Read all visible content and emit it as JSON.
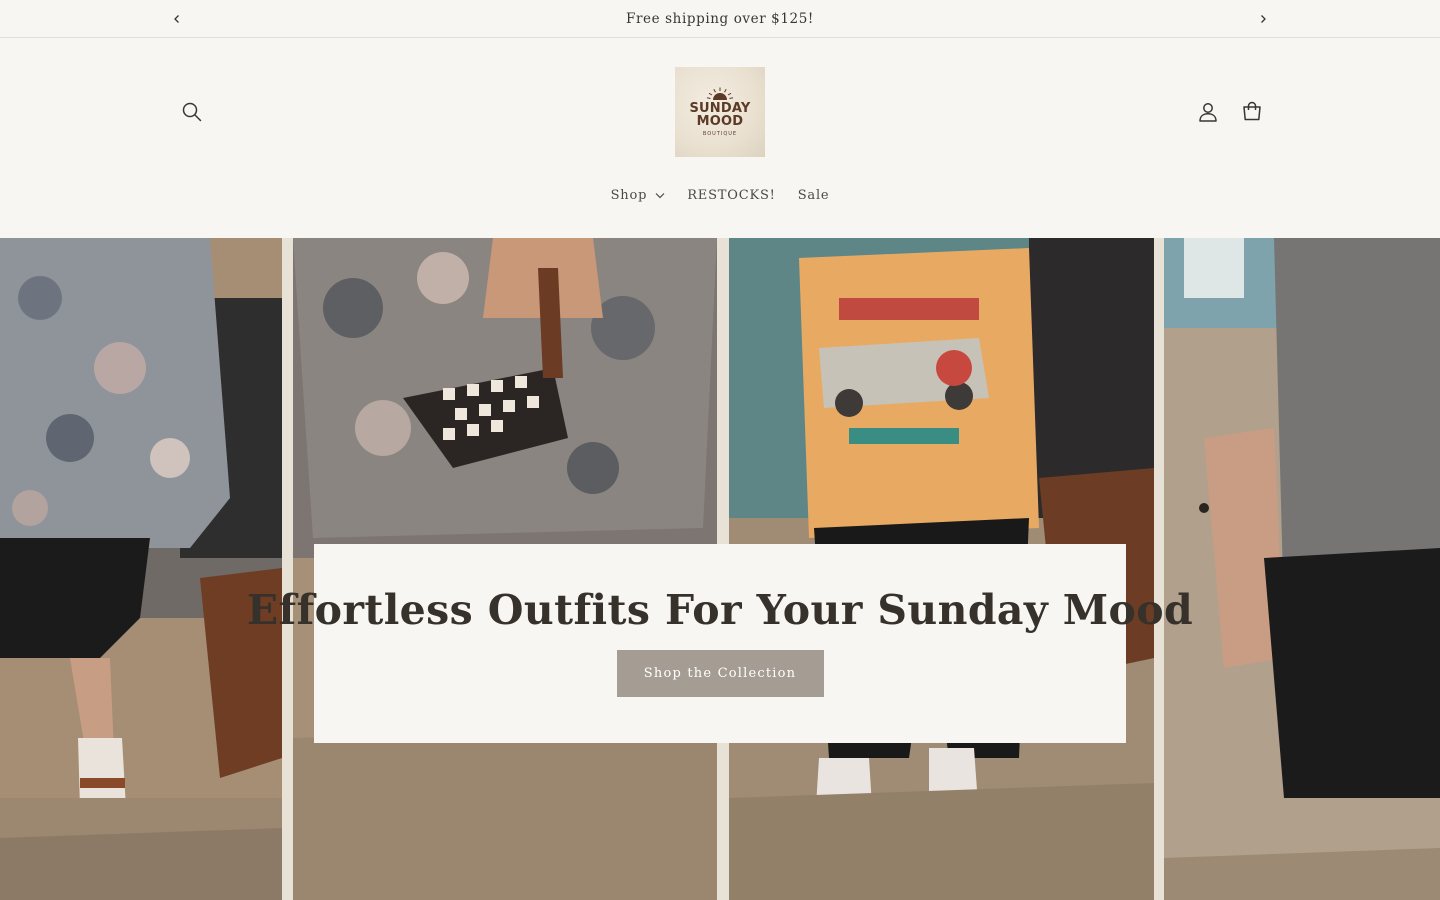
{
  "announcement": {
    "text": "Free shipping over $125!",
    "prev_icon": "chevron-left-icon",
    "next_icon": "chevron-right-icon"
  },
  "header": {
    "logo": {
      "line1": "SUNDAY",
      "line2": "MOOD",
      "line3": "BOUTIQUE"
    },
    "icons": [
      "search-icon",
      "account-icon",
      "cart-icon"
    ],
    "nav": [
      {
        "label": "Shop",
        "has_dropdown": true
      },
      {
        "label": "RESTOCKS!"
      },
      {
        "label": "Sale"
      }
    ]
  },
  "hero": {
    "title": "Effortless Outfits For Your Sunday Mood",
    "cta_label": "Shop the Collection"
  },
  "colors": {
    "background": "#f8f6f2",
    "text": "#3a3532",
    "button": "#a59d94",
    "logo_brown": "#5b3a26"
  }
}
